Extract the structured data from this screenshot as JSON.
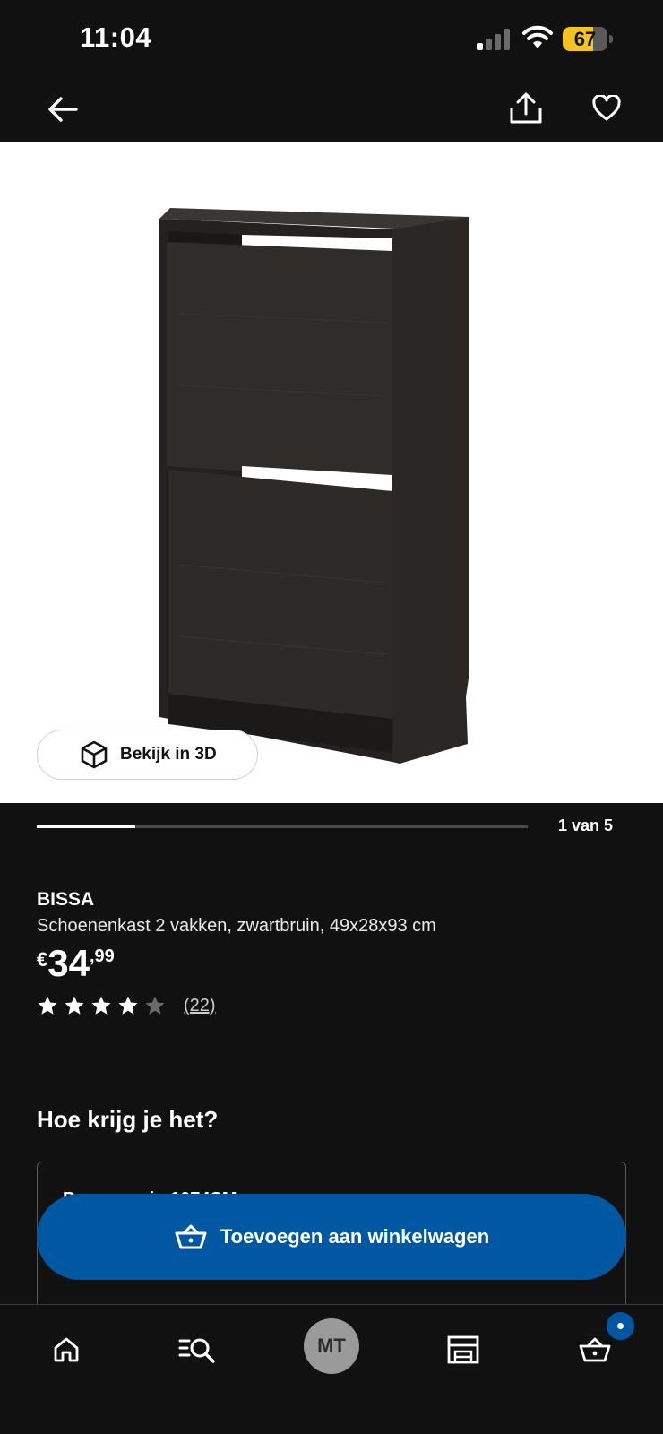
{
  "status_bar": {
    "time": "11:04",
    "battery_level": "67",
    "battery_fraction": 0.67,
    "signal_icon": "cellular-signal-icon",
    "wifi_icon": "wifi-icon"
  },
  "nav": {
    "back_icon": "arrow-left-icon",
    "share_icon": "share-icon",
    "favorite_icon": "heart-icon"
  },
  "gallery": {
    "view_3d_label": "Bekijk in 3D",
    "position_text": "1 van 5",
    "current": 1,
    "total": 5
  },
  "product": {
    "name": "BISSA",
    "description": "Schoenenkast 2 vakken, zwartbruin, 49x28x93 cm",
    "price_currency": "€",
    "price_integer": "34",
    "price_decimal": ",99",
    "rating": 4,
    "rating_max": 5,
    "review_count": "(22)"
  },
  "delivery": {
    "section_title": "Hoe krijg je het?",
    "peek_text": "Bezorgen in 1074SM"
  },
  "cta": {
    "add_to_cart_label": "Toevoegen aan winkelwagen"
  },
  "tabbar": {
    "avatar_initials": "MT",
    "items": [
      "home-icon",
      "search-list-icon",
      "avatar",
      "store-icon",
      "cart-icon"
    ]
  },
  "colors": {
    "background": "#111111",
    "accent_blue": "#0058a3",
    "battery_yellow": "#f2c41d"
  }
}
